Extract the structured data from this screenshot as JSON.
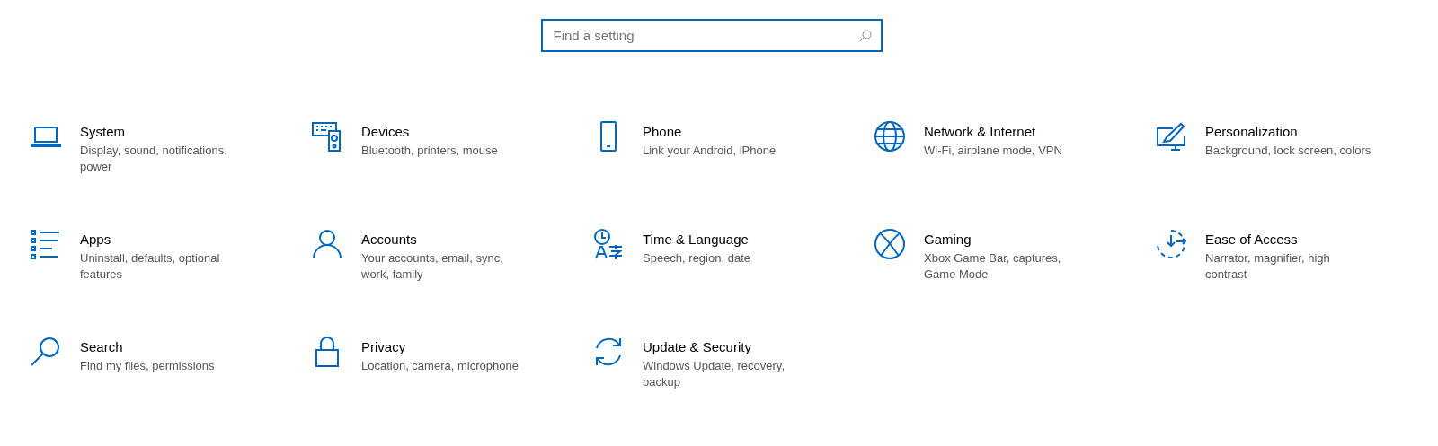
{
  "search": {
    "placeholder": "Find a setting"
  },
  "categories": [
    {
      "title": "System",
      "description": "Display, sound, notifications, power"
    },
    {
      "title": "Devices",
      "description": "Bluetooth, printers, mouse"
    },
    {
      "title": "Phone",
      "description": "Link your Android, iPhone"
    },
    {
      "title": "Network & Internet",
      "description": "Wi-Fi, airplane mode, VPN"
    },
    {
      "title": "Personalization",
      "description": "Background, lock screen, colors"
    },
    {
      "title": "Apps",
      "description": "Uninstall, defaults, optional features"
    },
    {
      "title": "Accounts",
      "description": "Your accounts, email, sync, work, family"
    },
    {
      "title": "Time & Language",
      "description": "Speech, region, date"
    },
    {
      "title": "Gaming",
      "description": "Xbox Game Bar, captures, Game Mode"
    },
    {
      "title": "Ease of Access",
      "description": "Narrator, magnifier, high contrast"
    },
    {
      "title": "Search",
      "description": "Find my files, permissions"
    },
    {
      "title": "Privacy",
      "description": "Location, camera, microphone"
    },
    {
      "title": "Update & Security",
      "description": "Windows Update, recovery, backup"
    }
  ]
}
